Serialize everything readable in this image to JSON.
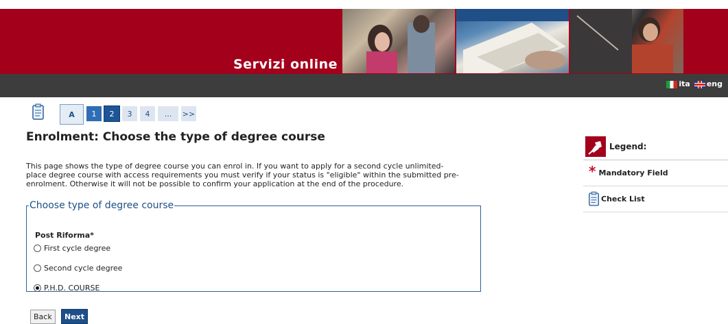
{
  "header": {
    "brand": "Servizi online",
    "languages": [
      {
        "code": "ita",
        "label": "ita"
      },
      {
        "code": "eng",
        "label": "eng"
      }
    ]
  },
  "steps": {
    "items": [
      "A",
      "1",
      "2",
      "3",
      "4",
      "...",
      ">>"
    ],
    "current": "2"
  },
  "page": {
    "title": "Enrolment: Choose the type of degree course",
    "intro_lines": [
      "This page shows the type of degree course you can enrol in. If you want to apply for a second cycle unlimited-",
      "place degree course with access requirements you must verify if your status is \"eligible\" within the submitted pre-",
      "enrolment. Otherwise it will not be possible to confirm your application at the end of the procedure."
    ]
  },
  "form": {
    "legend": "Choose type of degree course",
    "group_label": "Post Riforma*",
    "options": [
      {
        "label": "First cycle degree",
        "selected": false
      },
      {
        "label": "Second cycle degree",
        "selected": false
      },
      {
        "label": "P.H.D. COURSE",
        "selected": true
      }
    ]
  },
  "buttons": {
    "back": "Back",
    "next": "Next"
  },
  "legend_panel": {
    "title": "Legend:",
    "mandatory": "Mandatory Field",
    "checklist": "Check List"
  },
  "colors": {
    "brand_red": "#a3001c",
    "nav_dark": "#3d3d3d",
    "accent_blue": "#1d4f8a"
  }
}
